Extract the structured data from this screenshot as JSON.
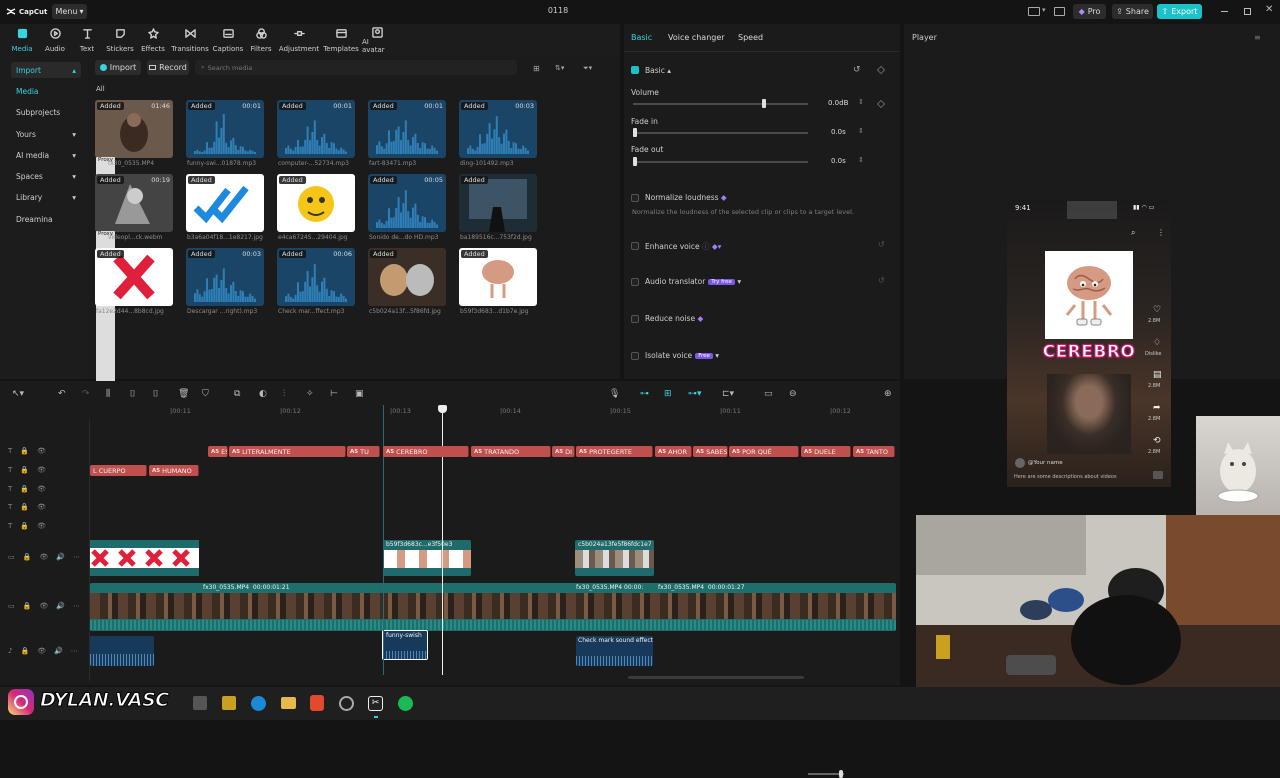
{
  "app": {
    "logo_text": "CapCut",
    "menu_label": "Menu",
    "title": "0118",
    "pro_label": "Pro",
    "share_label": "Share",
    "export_label": "Export"
  },
  "toolbar": [
    {
      "label": "Media",
      "icon": "media-icon"
    },
    {
      "label": "Audio",
      "icon": "audio-icon"
    },
    {
      "label": "Text",
      "icon": "text-icon"
    },
    {
      "label": "Stickers",
      "icon": "stickers-icon"
    },
    {
      "label": "Effects",
      "icon": "effects-icon"
    },
    {
      "label": "Transitions",
      "icon": "transitions-icon"
    },
    {
      "label": "Captions",
      "icon": "captions-icon"
    },
    {
      "label": "Filters",
      "icon": "filters-icon"
    },
    {
      "label": "Adjustment",
      "icon": "adjustment-icon"
    },
    {
      "label": "Templates",
      "icon": "templates-icon"
    },
    {
      "label": "AI avatar",
      "icon": "ai-avatar-icon"
    }
  ],
  "sidebar": [
    {
      "label": "Import"
    },
    {
      "label": "Media"
    },
    {
      "label": "Subprojects"
    },
    {
      "label": "Yours"
    },
    {
      "label": "AI media"
    },
    {
      "label": "Spaces"
    },
    {
      "label": "Library"
    },
    {
      "label": "Dreamina"
    }
  ],
  "media": {
    "import_label": "Import",
    "record_label": "Record",
    "search_placeholder": "Search media",
    "filter_all": "All",
    "added_label": "Added",
    "proxy_label": "Proxy",
    "items": [
      {
        "name": "fx30_0535.MP4",
        "duration": "01:46",
        "kind": "video"
      },
      {
        "name": "funny-swi...01878.mp3",
        "duration": "00:01",
        "kind": "audio"
      },
      {
        "name": "computer-...52734.mp3",
        "duration": "00:01",
        "kind": "audio"
      },
      {
        "name": "fart-83471.mp3",
        "duration": "00:01",
        "kind": "audio"
      },
      {
        "name": "ding-101492.mp3",
        "duration": "00:03",
        "kind": "audio"
      },
      {
        "name": "videopl...ck.webm",
        "duration": "00:19",
        "kind": "video"
      },
      {
        "name": "b3a6a04f18...1e8217.jpg",
        "duration": "",
        "kind": "image"
      },
      {
        "name": "e4ca6724S...29404.jpg",
        "duration": "",
        "kind": "image"
      },
      {
        "name": "Sonido de...do HD.mp3",
        "duration": "00:05",
        "kind": "audio"
      },
      {
        "name": "ba189516c...753f2d.jpg",
        "duration": "",
        "kind": "image"
      },
      {
        "name": "fa12e2d44...8b8cd.jpg",
        "duration": "",
        "kind": "image"
      },
      {
        "name": "Descargar ...right).mp3",
        "duration": "00:03",
        "kind": "audio"
      },
      {
        "name": "Check mar...ffect.mp3",
        "duration": "00:06",
        "kind": "audio"
      },
      {
        "name": "c5b024a13f...5f86fd.jpg",
        "duration": "",
        "kind": "image"
      },
      {
        "name": "b59f3d683...d1b7e.jpg",
        "duration": "",
        "kind": "image"
      }
    ]
  },
  "props": {
    "tabs": [
      "Basic",
      "Voice changer",
      "Speed"
    ],
    "section": "Basic",
    "volume_label": "Volume",
    "volume_value": "0.0dB",
    "volume_level": 0.75,
    "fadein_label": "Fade in",
    "fadein_value": "0.0s",
    "fadeout_label": "Fade out",
    "fadeout_value": "0.0s",
    "normalize_label": "Normalize loudness",
    "normalize_desc": "Normalize the loudness of the selected clip or clips to a target level.",
    "enhance_label": "Enhance voice",
    "translator_label": "Audio translator",
    "translator_badge": "Try free",
    "reduce_label": "Reduce noise",
    "isolate_label": "Isolate voice",
    "isolate_badge": "Free"
  },
  "player": {
    "title": "Player",
    "phone_time": "9:41",
    "caption": "CEREBRO",
    "username": "@Your name",
    "desc": "Here are some descriptions about videos",
    "like_count": "2.8M",
    "dislike_label": "Dislike",
    "comment_count": "2.8M",
    "share_count": "2.8M",
    "remix_count": "2.8M"
  },
  "timeline": {
    "ruler": [
      "|00:11",
      "|00:12",
      "|00:13",
      "|00:14",
      "|00:15"
    ],
    "text_clips_row1": [
      "ES",
      "LITERALMENTE",
      "TU",
      "CEREBRO",
      "TRATANDO",
      "DI",
      "PROTEGERTE",
      "AHOR",
      "SABES",
      "POR QUÉ",
      "DUELE",
      "TANTO"
    ],
    "text_clips_row2": [
      "L CUERPO",
      "HUMANO"
    ],
    "text_clip_tag": "A5",
    "overlay_clips": [
      "b59f3d683c...e3f50e3",
      "c5b024a13fe5f86fdc1e7"
    ],
    "video_clips": [
      {
        "name": "fx30_0535.MP4",
        "duration": "00:00:01:21"
      },
      {
        "name": "fx30_0535.MP4",
        "duration": "00:00:"
      },
      {
        "name": "fx30_0535.MP4",
        "duration": "00:00:01:27"
      }
    ],
    "audio_clips": [
      "funny-swish",
      "Check mark sound effect"
    ]
  },
  "overlay": {
    "handle": "DYLAN.VASC"
  }
}
